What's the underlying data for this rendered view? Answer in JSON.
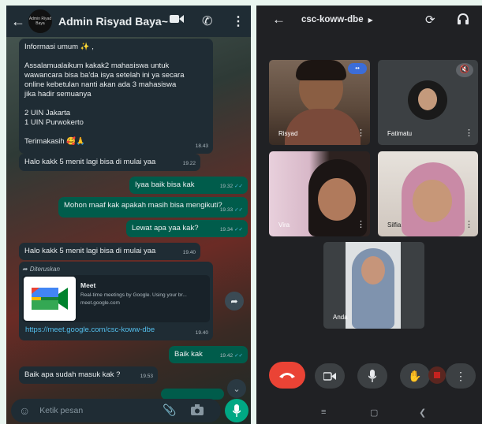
{
  "whatsapp": {
    "title": "Admin Risyad Baya~",
    "avatar_text": "Admin Riyad Baya",
    "messages": [
      {
        "dir": "in",
        "lines": [
          "Informasi umum ✨ ,",
          "",
          "Assalamualaikum kakak2 mahasiswa untuk",
          "wawancara bisa ba'da isya setelah ini ya secara",
          "online  kebetulan nanti akan ada 3 mahasiswa",
          "jika  hadir semuanya",
          "",
          "2 UIN Jakarta",
          "1 UIN Purwokerto",
          "",
          "Terimakasih 🥰🙏"
        ],
        "time": "18.43"
      },
      {
        "dir": "in",
        "lines": [
          "Halo kakk 5 menit lagi bisa di mulai yaa"
        ],
        "time": "19.22"
      },
      {
        "dir": "out",
        "lines": [
          "Iyaa baik bisa kak"
        ],
        "time": "19.32"
      },
      {
        "dir": "out",
        "lines": [
          "Mohon maaf kak apakah masih bisa mengikuti?"
        ],
        "time": "19.33"
      },
      {
        "dir": "out",
        "lines": [
          "Lewat apa yaa kak?"
        ],
        "time": "19.34"
      },
      {
        "dir": "in",
        "lines": [
          "Halo kakk 5 menit lagi bisa di mulai yaa"
        ],
        "time": "19.40"
      },
      {
        "dir": "out",
        "lines": [
          "Baik kak"
        ],
        "time": "19.42"
      },
      {
        "dir": "in",
        "lines": [
          "Baik apa sudah masuk kak ?"
        ],
        "time": "19.53"
      }
    ],
    "forward": {
      "label": "Diteruskan",
      "link_title": "Meet",
      "link_desc": "Real-time meetings by Google. Using your br...",
      "link_domain": "meet.google.com",
      "url": "https://meet.google.com/csc-koww-dbe",
      "time": "19.40"
    },
    "input_placeholder": "Ketik pesan"
  },
  "meet": {
    "meeting_code": "csc-koww-dbe",
    "participants": [
      {
        "name": "Risyad"
      },
      {
        "name": "Fatimatu"
      },
      {
        "name": "Vira"
      },
      {
        "name": "Silfia"
      },
      {
        "name": "Anda"
      }
    ],
    "controls": [
      "end-call",
      "camera",
      "microphone",
      "raise-hand",
      "more"
    ]
  },
  "colors": {
    "wa_header": "#1f2c34",
    "wa_out": "#005c4b",
    "wa_in": "#1f2c34",
    "meet_bg": "#202124",
    "end_call": "#ea4335",
    "wa_green": "#00a884"
  }
}
